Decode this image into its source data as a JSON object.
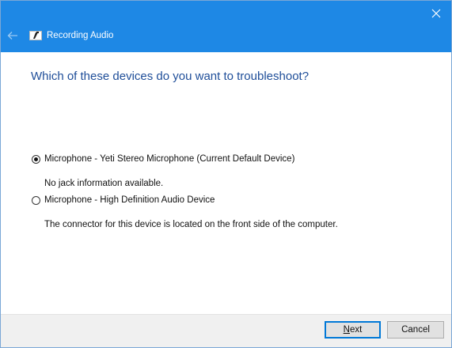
{
  "window": {
    "title": "Recording Audio",
    "accent_color": "#1e88e5"
  },
  "titlebar": {
    "back_icon": "back-arrow-icon",
    "close_icon": "close-icon",
    "app_icon": "recording-audio-icon"
  },
  "main": {
    "question": "Which of these devices do you want to troubleshoot?",
    "options": [
      {
        "label": "Microphone - Yeti Stereo Microphone (Current Default Device)",
        "description": "No jack information available.",
        "selected": true
      },
      {
        "label": "Microphone - High Definition Audio Device",
        "description": "The connector for this device is located on the front side of the computer.",
        "selected": false
      }
    ]
  },
  "footer": {
    "next_access_key": "N",
    "next_rest": "ext",
    "cancel_label": "Cancel"
  }
}
